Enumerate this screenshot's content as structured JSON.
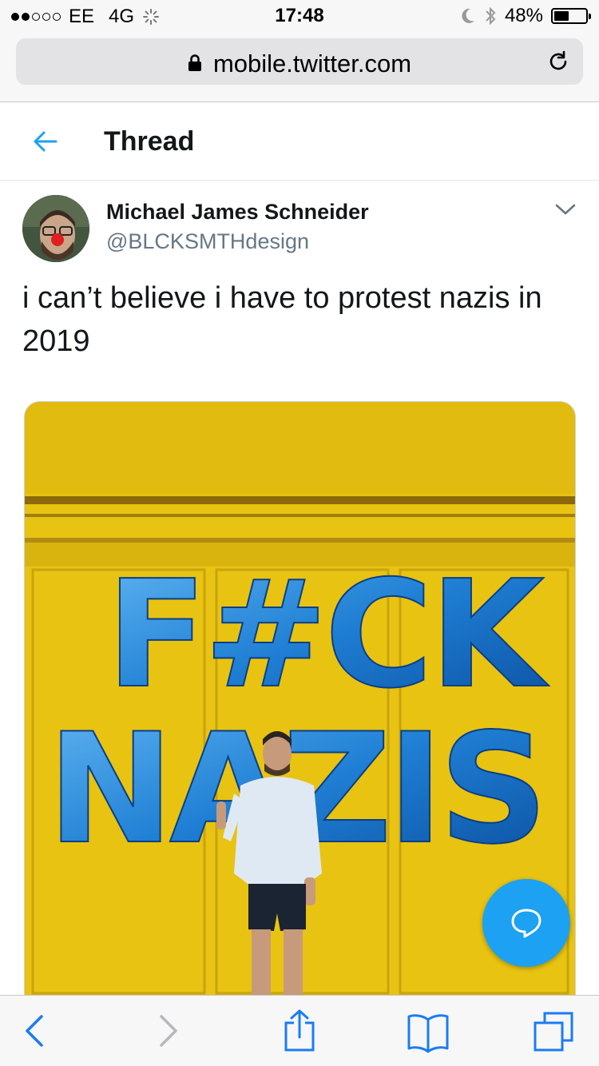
{
  "status_bar": {
    "carrier": "EE",
    "network": "4G",
    "time": "17:48",
    "battery_percent": "48%",
    "battery_level": 0.48
  },
  "browser": {
    "url": "mobile.twitter.com"
  },
  "header": {
    "title": "Thread"
  },
  "tweet": {
    "display_name": "Michael James Schneider",
    "handle": "@BLCKSMTHdesign",
    "text": "i can’t believe i have to protest nazis in 2019",
    "image_lettering": [
      "F#CK",
      "NAZIS"
    ]
  },
  "colors": {
    "accent": "#1da1f2",
    "ios_blue": "#1a7cf5",
    "image_background": "#e8c311",
    "balloon": "#1f7fd4"
  },
  "icons": {
    "back": "back-arrow-icon",
    "caret": "chevron-down-icon",
    "compose": "reply-bubble-icon",
    "lock": "lock-icon",
    "reload": "reload-icon"
  }
}
